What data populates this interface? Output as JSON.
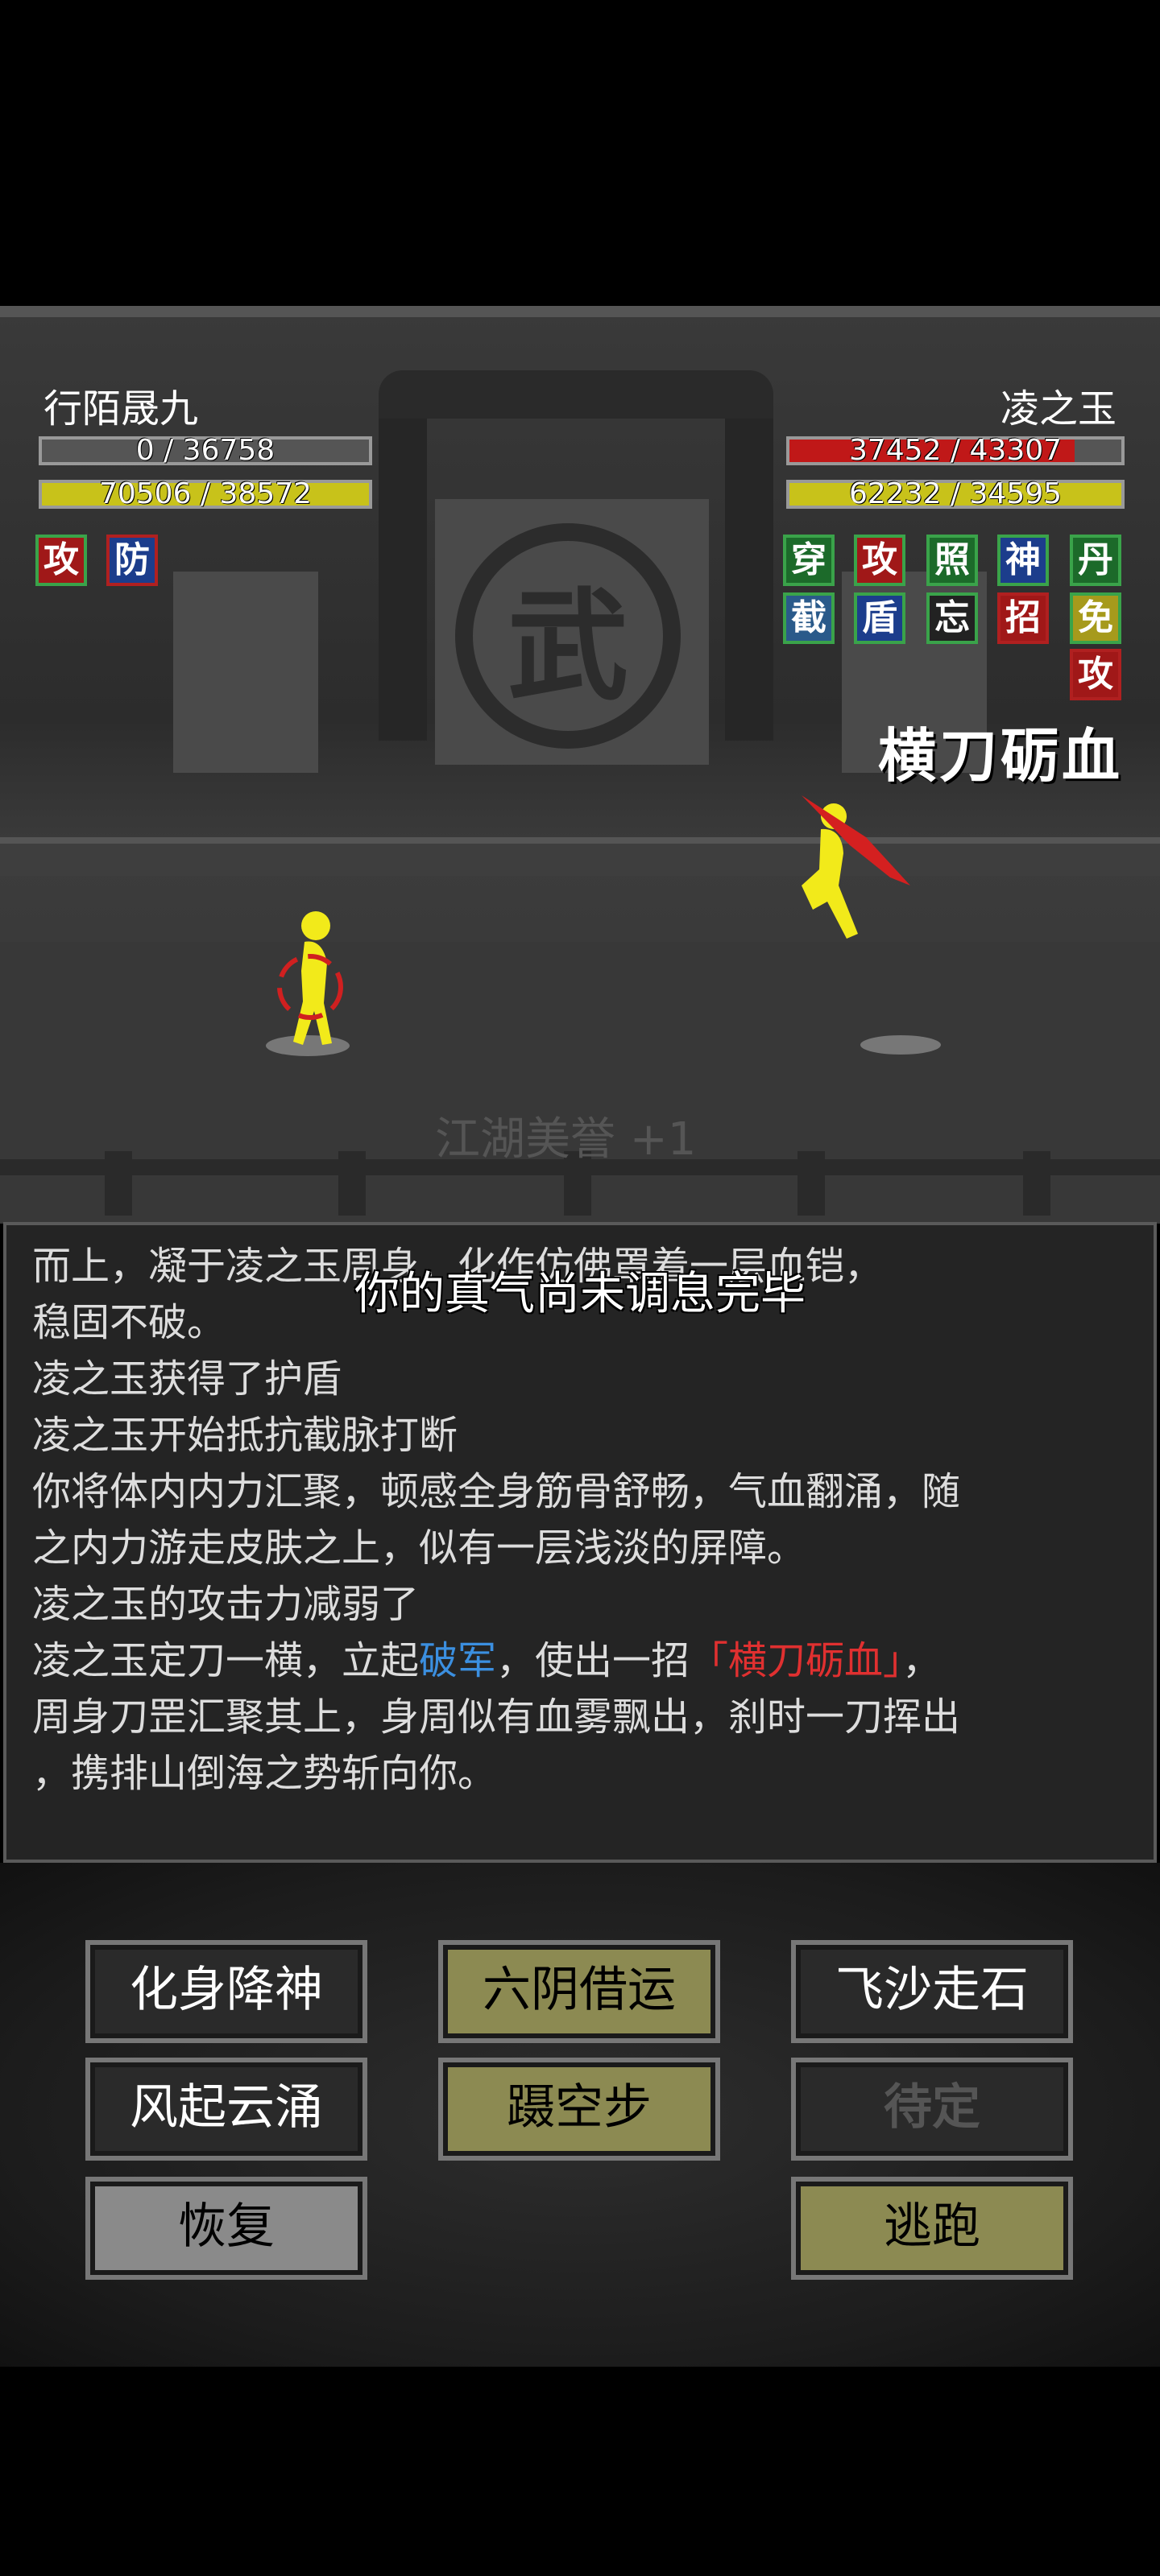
{
  "player": {
    "name": "行陌晟九",
    "hp_text": "0 / 36758",
    "hp_fraction": 0.0,
    "mp_text": "70506 / 38572",
    "mp_fraction": 1.0,
    "buffs": [
      "攻",
      "防"
    ]
  },
  "enemy": {
    "name": "凌之玉",
    "hp_text": "37452 / 43307",
    "hp_fraction": 0.86,
    "mp_text": "62232 / 34595",
    "mp_fraction": 1.0,
    "buffs_row1": [
      "穿",
      "攻",
      "照",
      "神",
      "丹"
    ],
    "buffs_row2": [
      "截",
      "盾",
      "忘",
      "招",
      "免"
    ],
    "buffs_row3": [
      "攻"
    ],
    "current_skill": "横刀砺血"
  },
  "stage": {
    "plaque": "武",
    "honor_text": "江湖美誉 +1"
  },
  "toast": "你的真气尚未调息完毕",
  "log": {
    "line1": "而上，凝于凌之玉周身，化作仿佛罩着一层血铠，",
    "line2": "稳固不破。",
    "line3": "凌之玉获得了护盾",
    "line4": "凌之玉开始抵抗截脉打断",
    "line5": "你将体内内力汇聚，顿感全身筋骨舒畅，气血翻涌，随",
    "line6": "之内力游走皮肤之上，似有一层浅淡的屏障。",
    "line7": "凌之玉的攻击力减弱了",
    "line8_a": "凌之玉定刀一横，立起",
    "line8_b": "破军",
    "line8_c": "，使出一招",
    "line8_d": "「横刀砺血」",
    "line8_e": "，",
    "line9": "周身刀罡汇聚其上，身周似有血雾飘出，刹时一刀挥出",
    "line10": "，携排山倒海之势斩向你。"
  },
  "commands": {
    "b1": "化身降神",
    "b2": "六阴借运",
    "b3": "飞沙走石",
    "b4": "风起云涌",
    "b5": "蹑空步",
    "b6": "待定",
    "b7": "恢复",
    "b8": "逃跑"
  }
}
